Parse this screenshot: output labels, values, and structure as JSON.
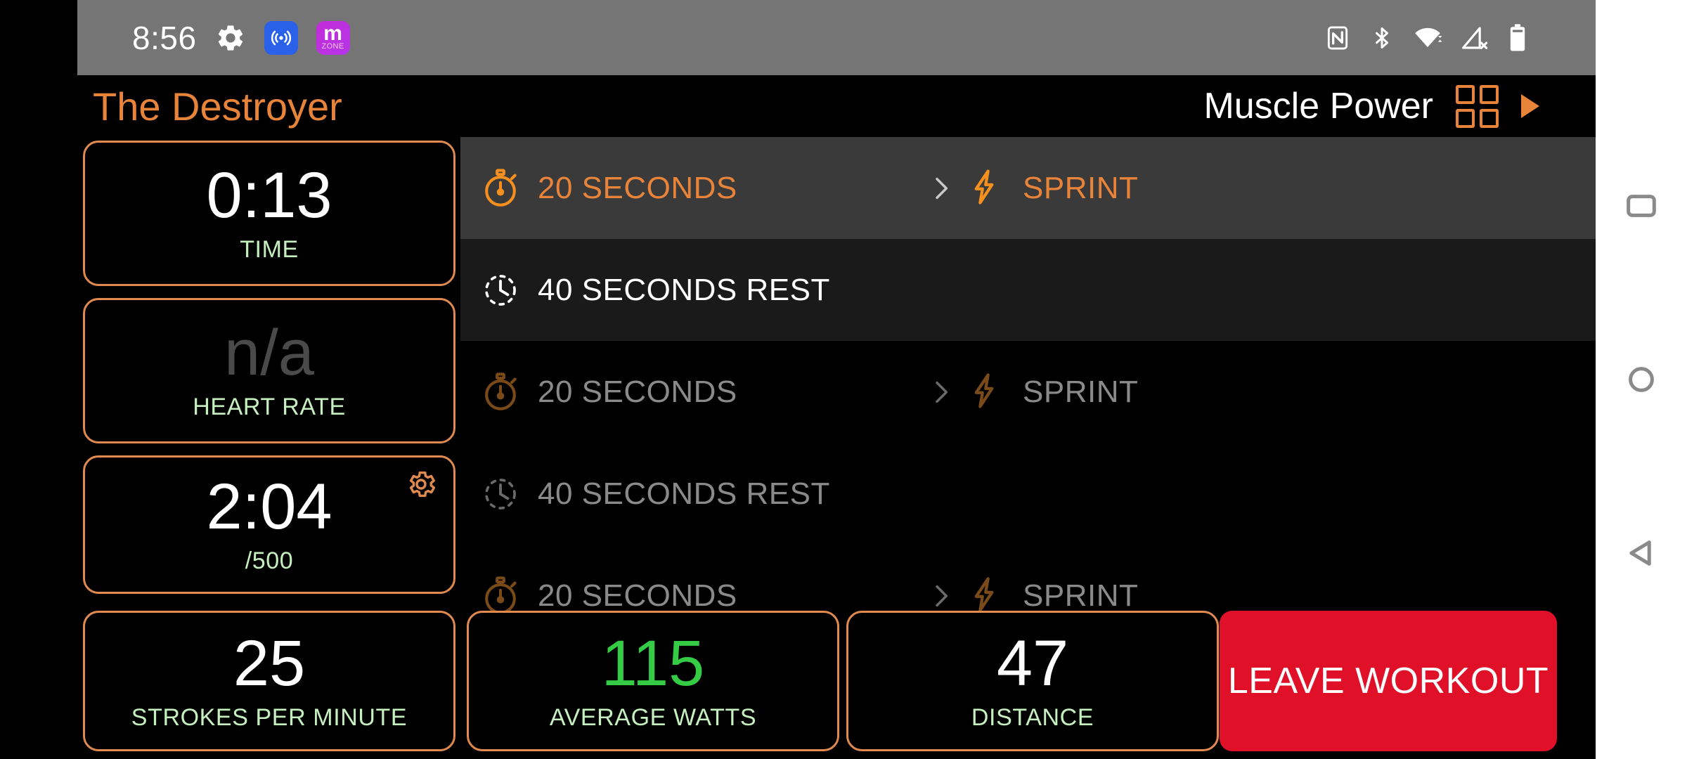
{
  "status_bar": {
    "clock": "8:56",
    "left_icons": [
      "gear-icon",
      "cast-icon",
      "myzone-app-icon"
    ],
    "myzone_badge": {
      "letter": "m",
      "sub": "ZONE"
    },
    "right_icons": [
      "nfc-icon",
      "bluetooth-icon",
      "wifi-icon",
      "cellular-off-icon",
      "battery-icon"
    ],
    "background": "#757575"
  },
  "header": {
    "workout_title": "The Destroyer",
    "section_name": "Muscle Power",
    "grid_button": "grid-view-button",
    "play_button": "play-button",
    "accent": "#E8833A"
  },
  "stats": {
    "time": {
      "value": "0:13",
      "label": "TIME"
    },
    "heartrate": {
      "value": "n/a",
      "label": "HEART RATE"
    },
    "pace": {
      "value": "2:04",
      "label": "/500"
    },
    "spm": {
      "value": "25",
      "label": "STROKES PER MINUTE"
    },
    "watts": {
      "value": "115",
      "label": "AVERAGE WATTS"
    },
    "distance": {
      "value": "47",
      "label": "DISTANCE"
    }
  },
  "leave_button": {
    "label": "LEAVE WORKOUT",
    "color": "#E01029"
  },
  "workout_list": {
    "rows": [
      {
        "duration": "20 SECONDS",
        "effort": "SPRINT",
        "duration_icon": "stopwatch-icon",
        "effort_icon": "lightning-bolt-icon",
        "separator": ">",
        "state": "active"
      },
      {
        "duration": "40 SECONDS REST",
        "effort": "",
        "duration_icon": "clock-rest-icon",
        "effort_icon": "",
        "separator": "",
        "state": "rest"
      },
      {
        "duration": "20 SECONDS",
        "effort": "SPRINT",
        "duration_icon": "stopwatch-icon",
        "effort_icon": "lightning-bolt-icon",
        "separator": ">",
        "state": "dim"
      },
      {
        "duration": "40 SECONDS REST",
        "effort": "",
        "duration_icon": "clock-rest-icon",
        "effort_icon": "",
        "separator": "",
        "state": "dim"
      },
      {
        "duration": "20 SECONDS",
        "effort": "SPRINT",
        "duration_icon": "stopwatch-icon",
        "effort_icon": "lightning-bolt-icon",
        "separator": ">",
        "state": "dim"
      }
    ]
  },
  "nav_bar": {
    "buttons": [
      "recents-button",
      "home-button",
      "back-button"
    ]
  },
  "colors": {
    "accent_orange": "#E8833A",
    "card_border": "#E08A50",
    "label_green": "#C5EFBE",
    "value_green": "#33CC44",
    "danger_red": "#E01029"
  }
}
